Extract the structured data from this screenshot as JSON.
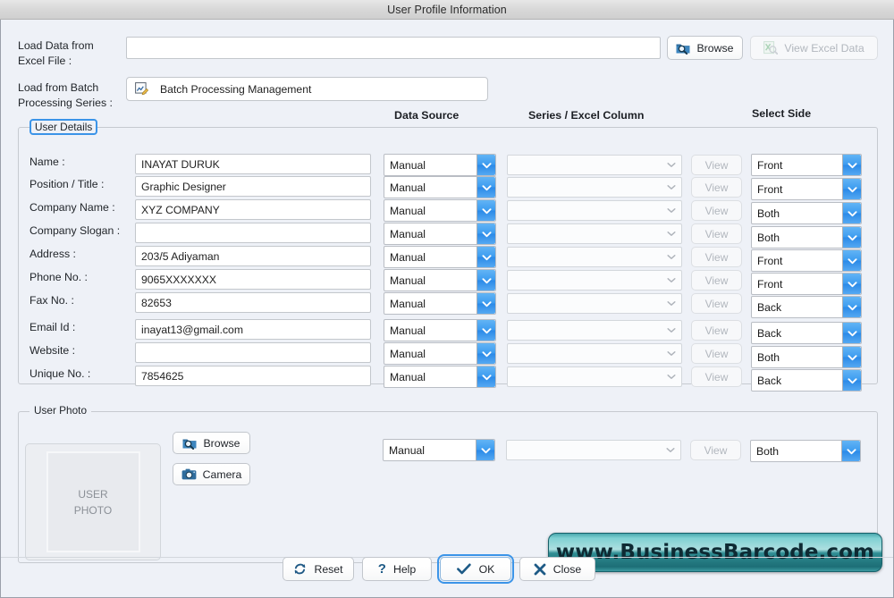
{
  "window": {
    "title": "User Profile Information"
  },
  "top": {
    "excel_label_line1": "Load Data from",
    "excel_label_line2": "Excel File :",
    "excel_path_value": "",
    "excel_path_placeholder": "",
    "browse_label": "Browse",
    "view_excel_label": "View Excel Data",
    "batch_label_line1": "Load from Batch",
    "batch_label_line2": "Processing Series :",
    "batch_value": "Batch Processing Management"
  },
  "columns": {
    "data_source": "Data Source",
    "series_excel_column": "Series / Excel Column",
    "select_side": "Select Side"
  },
  "user_details": {
    "legend": "User Details",
    "view_label": "View",
    "rows": [
      {
        "label": "Name :",
        "value": "INAYAT DURUK",
        "data_source": "Manual",
        "series": "",
        "side": "Front"
      },
      {
        "label": "Position / Title :",
        "value": "Graphic Designer",
        "data_source": "Manual",
        "series": "",
        "side": "Front"
      },
      {
        "label": "Company Name :",
        "value": "XYZ COMPANY",
        "data_source": "Manual",
        "series": "",
        "side": "Both"
      },
      {
        "label": "Company Slogan :",
        "value": "",
        "data_source": "Manual",
        "series": "",
        "side": "Both"
      },
      {
        "label": "Address :",
        "value": "203/5 Adiyaman",
        "data_source": "Manual",
        "series": "",
        "side": "Front"
      },
      {
        "label": "Phone No. :",
        "value": "9065XXXXXXX",
        "data_source": "Manual",
        "series": "",
        "side": "Front"
      },
      {
        "label": "Fax No. :",
        "value": "82653",
        "data_source": "Manual",
        "series": "",
        "side": "Back"
      },
      {
        "label": "Email Id :",
        "value": "inayat13@gmail.com",
        "data_source": "Manual",
        "series": "",
        "side": "Back"
      },
      {
        "label": "Website :",
        "value": "",
        "data_source": "Manual",
        "series": "",
        "side": "Both"
      },
      {
        "label": "Unique No. :",
        "value": "7854625",
        "data_source": "Manual",
        "series": "",
        "side": "Back"
      }
    ]
  },
  "user_photo": {
    "legend": "User Photo",
    "placeholder_line1": "USER",
    "placeholder_line2": "PHOTO",
    "browse_label": "Browse",
    "camera_label": "Camera",
    "data_source": "Manual",
    "series": "",
    "view_label": "View",
    "side": "Both"
  },
  "footer": {
    "reset_label": "Reset",
    "help_label": "Help",
    "ok_label": "OK",
    "close_label": "Close"
  },
  "watermark": {
    "text": "www.BusinessBarcode.com"
  },
  "theme": {
    "accent_blue": "#3d9cf0",
    "focus_blue": "#3b94e8",
    "window_bg": "#eef1f7",
    "watermark_teal": "#2f8d93"
  }
}
